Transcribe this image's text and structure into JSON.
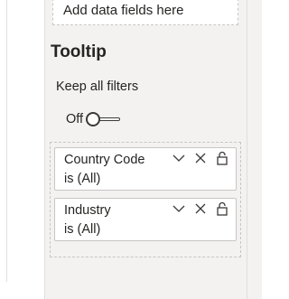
{
  "fields_well": {
    "placeholder_text": "Add data fields here"
  },
  "tooltip_section": {
    "title": "Tooltip",
    "keep_all_filters_label": "Keep all filters",
    "toggle": {
      "state_label": "Off",
      "on": false
    }
  },
  "filters": [
    {
      "field": "Country Code",
      "condition": "is (All)"
    },
    {
      "field": "Industry",
      "condition": "is (All)"
    }
  ],
  "icons": {
    "expand": "chevron-down-icon",
    "remove": "close-icon",
    "lock": "lock-icon"
  }
}
